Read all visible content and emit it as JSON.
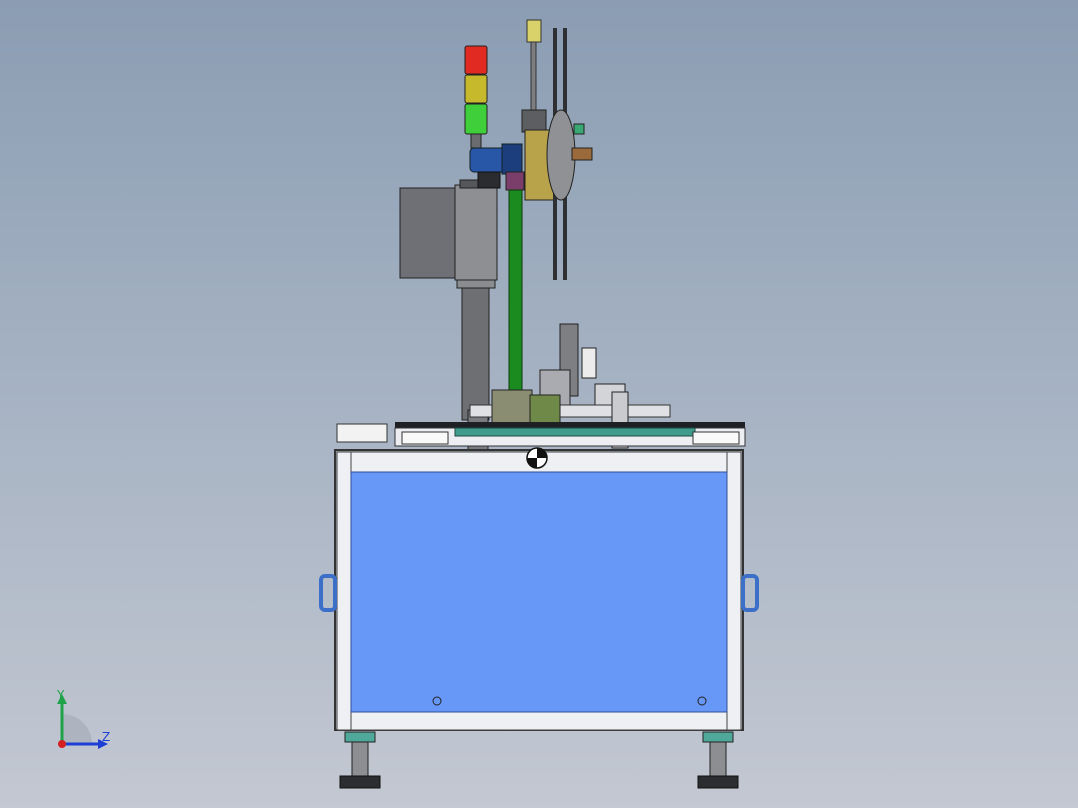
{
  "viewport": {
    "view": "cad-front-view",
    "background_top": "#8b9db3",
    "background_bottom": "#c3c8d2"
  },
  "triad": {
    "y_label": "Y",
    "z_label": "Z",
    "y_color": "#1fa34a",
    "z_color": "#1e3fd6",
    "x_color": "#d42020"
  },
  "colors": {
    "frame_panel": "#6797f7",
    "frame_rail": "#eef0f3",
    "green_rod": "#1b8a1f",
    "stack_light_red": "#e12a22",
    "stack_light_yellow": "#c6b92b",
    "stack_light_green": "#3fcf3a",
    "motor_blue": "#2857a8",
    "handle_blue": "#3b6fc8"
  }
}
